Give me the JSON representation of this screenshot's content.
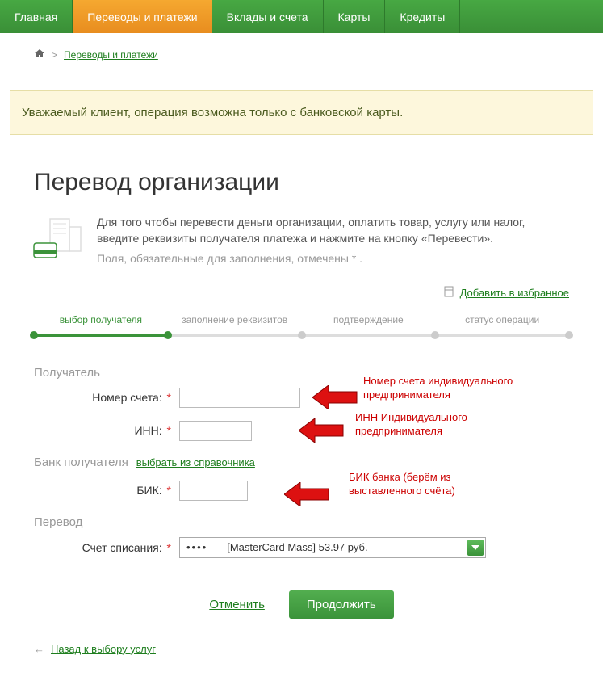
{
  "nav": {
    "items": [
      {
        "label": "Главная"
      },
      {
        "label": "Переводы и платежи"
      },
      {
        "label": "Вклады и счета"
      },
      {
        "label": "Карты"
      },
      {
        "label": "Кредиты"
      }
    ]
  },
  "breadcrumb": {
    "separator": ">",
    "link": "Переводы и платежи"
  },
  "notice": "Уважаемый клиент, операция возможна только с банковской карты.",
  "title": "Перевод организации",
  "intro": {
    "line1": "Для того чтобы перевести деньги организации, оплатить товар, услугу или налог, введите реквизиты получателя платежа и нажмите на кнопку «Перевести».",
    "line2": "Поля, обязательные для заполнения, отмечены * ."
  },
  "favorite": "Добавить в избранное",
  "steps": [
    {
      "label": "выбор получателя",
      "active": true
    },
    {
      "label": "заполнение реквизитов",
      "active": false
    },
    {
      "label": "подтверждение",
      "active": false
    },
    {
      "label": "статус операции",
      "active": false
    }
  ],
  "sections": {
    "recipient": "Получатель",
    "bank": "Банк получателя",
    "bank_ref": "выбрать из справочника",
    "transfer": "Перевод"
  },
  "fields": {
    "account": {
      "label": "Номер счета:",
      "value": ""
    },
    "inn": {
      "label": "ИНН:",
      "value": ""
    },
    "bik": {
      "label": "БИК:",
      "value": ""
    },
    "debit": {
      "label": "Счет списания:",
      "selected": "[MasterCard Mass] 53.97 руб.",
      "prefix_dots": "••••"
    }
  },
  "annotations": {
    "account": "Номер счета индивидуального предпринимателя",
    "inn": "ИНН Индивидуального предпринимателя",
    "bik": "БИК банка (берём из выставленного счёта)"
  },
  "buttons": {
    "cancel": "Отменить",
    "continue": "Продолжить"
  },
  "back_link": "Назад к выбору услуг",
  "back_arrow": "←"
}
